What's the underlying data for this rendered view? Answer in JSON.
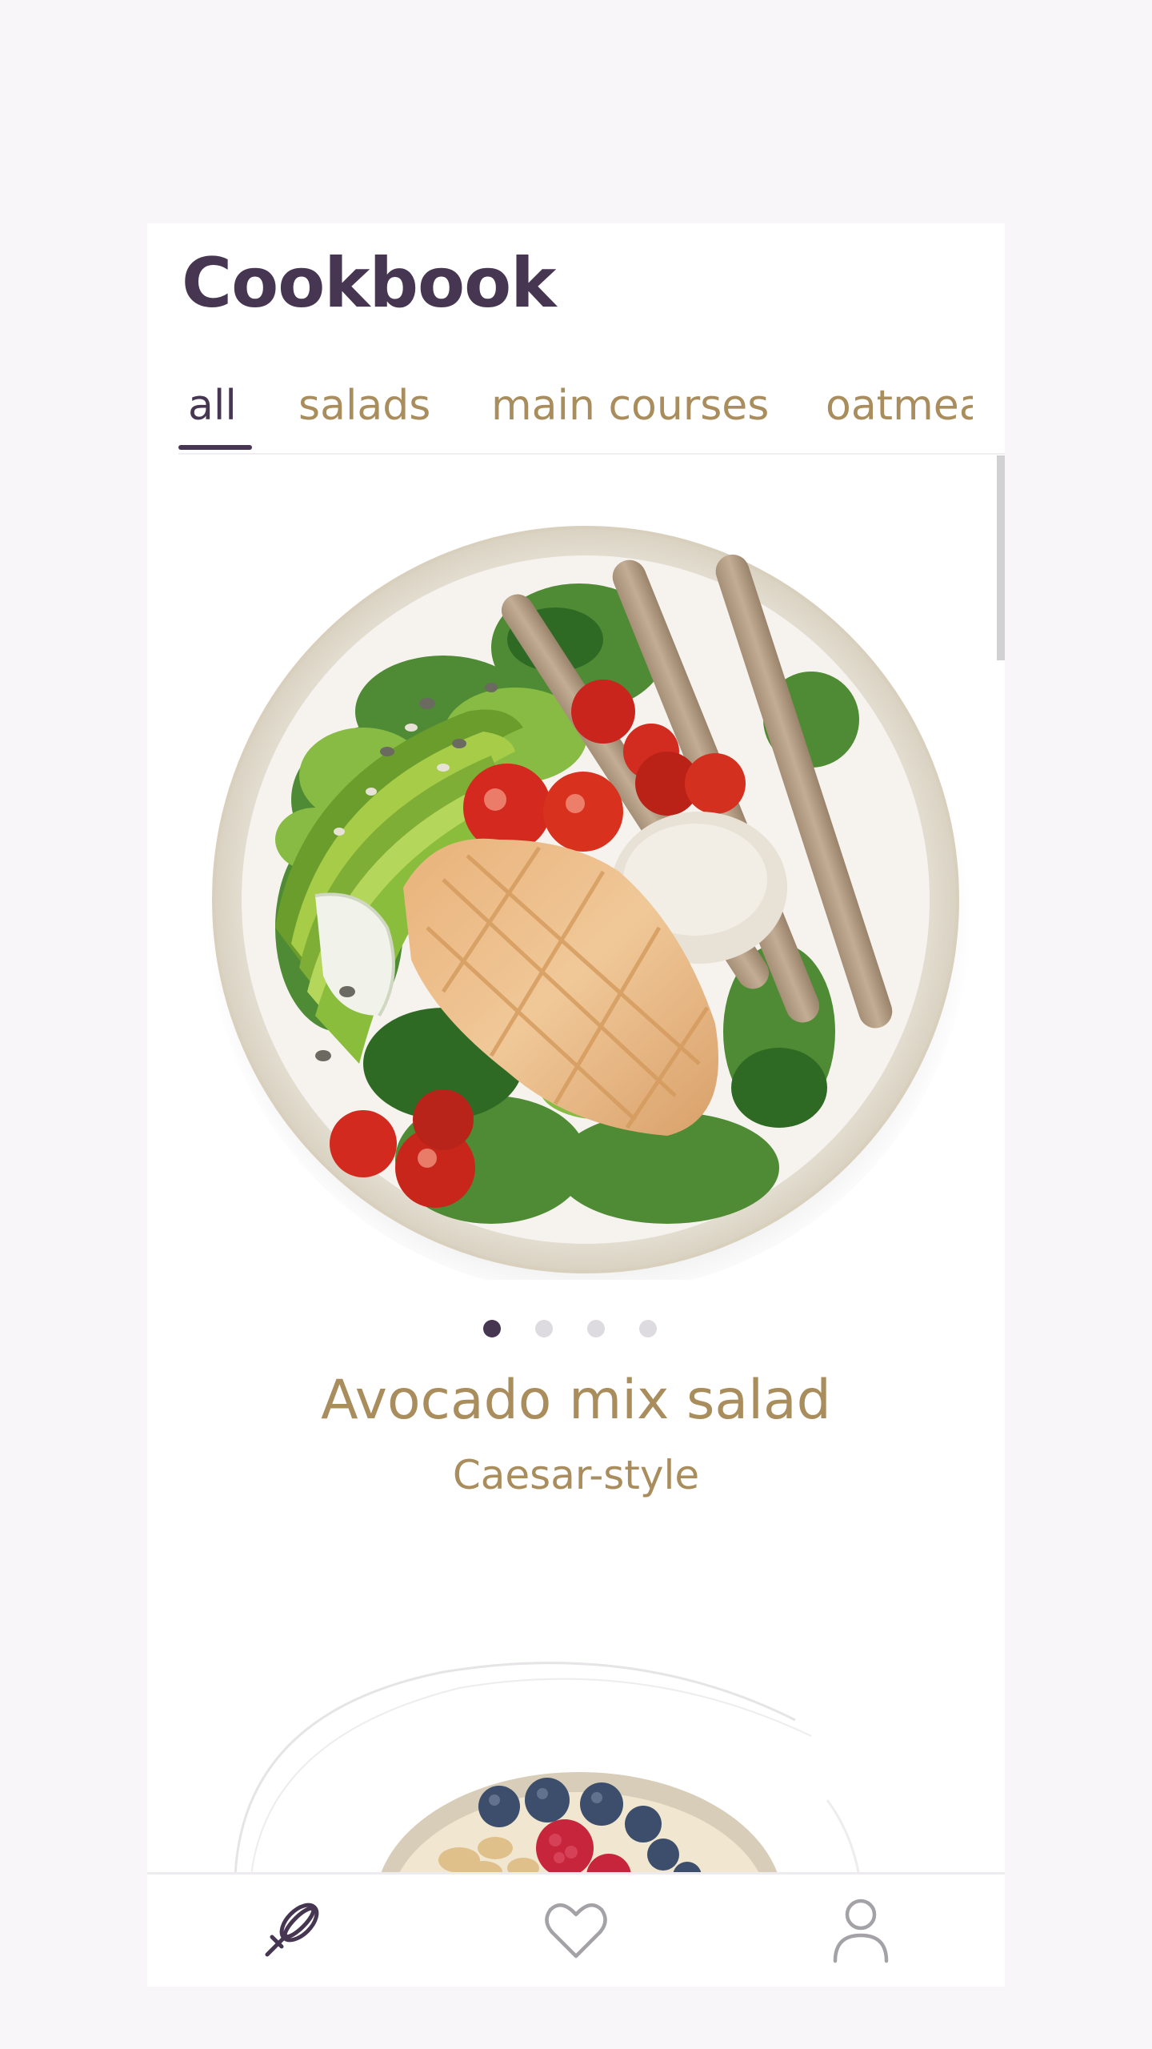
{
  "app": {
    "title": "Cookbook"
  },
  "tabs": [
    {
      "label": "all",
      "active": true
    },
    {
      "label": "salads",
      "active": false
    },
    {
      "label": "main courses",
      "active": false
    },
    {
      "label": "oatmeal",
      "active": false
    }
  ],
  "carousel": {
    "current_index": 1,
    "total": 4,
    "recipe_title": "Avocado mix salad",
    "recipe_subtitle": "Caesar-style"
  },
  "next_recipe": {
    "image_icon": "oatmeal-bowl-image"
  },
  "bottom_nav": {
    "items": [
      {
        "icon": "whisk-icon",
        "active": true
      },
      {
        "icon": "heart-icon",
        "active": false
      },
      {
        "icon": "user-icon",
        "active": false
      }
    ]
  },
  "colors": {
    "primary": "#463652",
    "accent_gold": "#a98d5c",
    "background": "#f8f6f9",
    "inactive_dot": "#dddbe0"
  }
}
